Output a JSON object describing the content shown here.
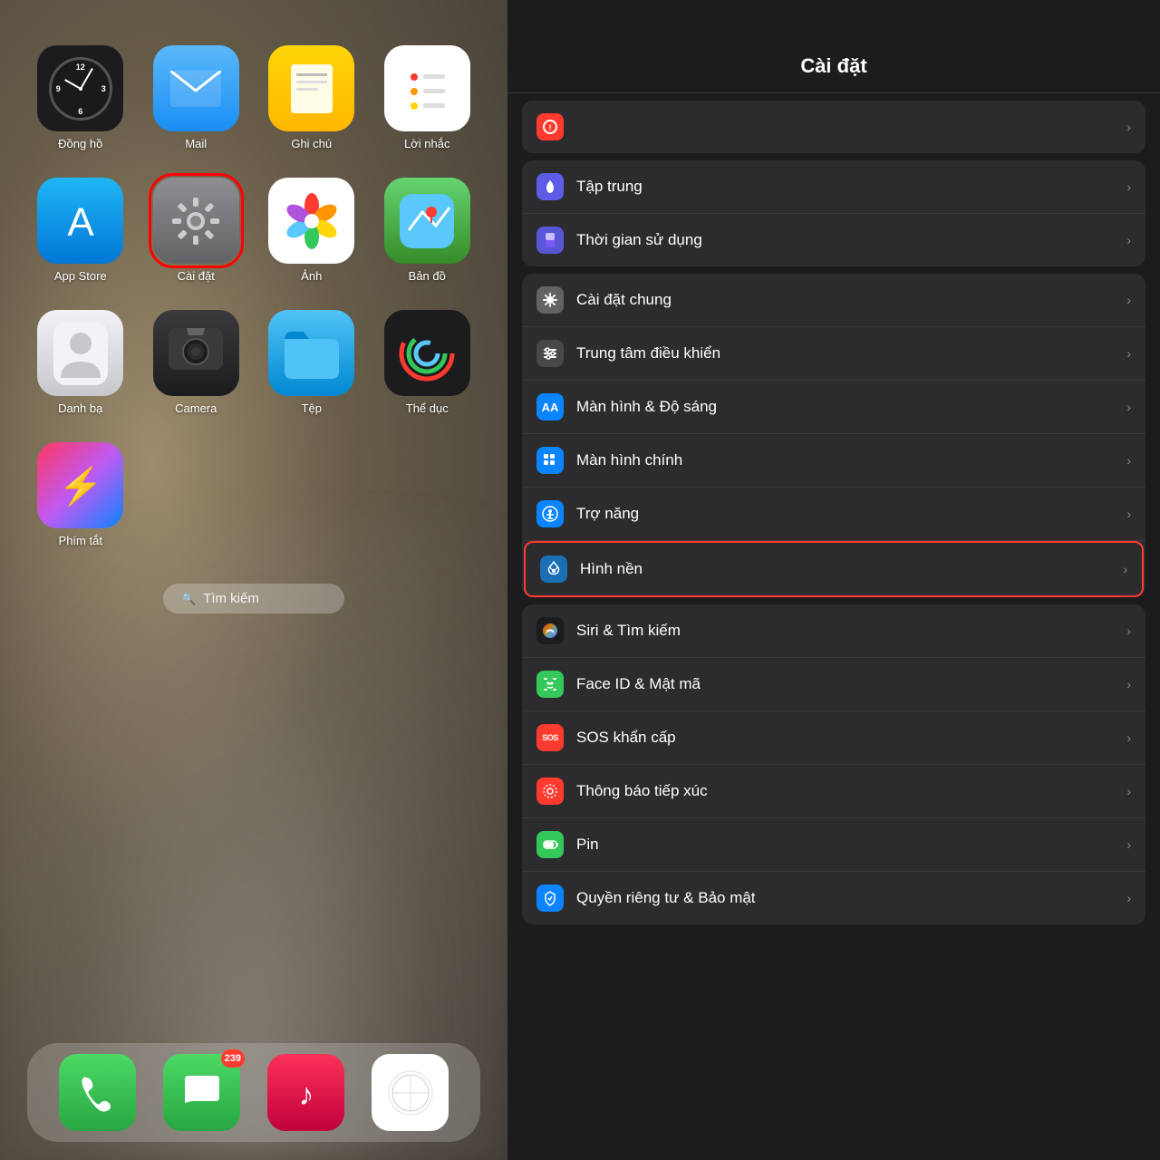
{
  "leftPanel": {
    "apps": [
      {
        "id": "clock",
        "label": "Đồng hồ",
        "icon": "clock"
      },
      {
        "id": "mail",
        "label": "Mail",
        "icon": "mail"
      },
      {
        "id": "notes",
        "label": "Ghi chú",
        "icon": "notes"
      },
      {
        "id": "reminders",
        "label": "Lời nhắc",
        "icon": "reminders"
      },
      {
        "id": "appstore",
        "label": "App Store",
        "icon": "appstore"
      },
      {
        "id": "settings",
        "label": "Cài đặt",
        "icon": "settings",
        "selected": true
      },
      {
        "id": "photos",
        "label": "Ảnh",
        "icon": "photos"
      },
      {
        "id": "maps",
        "label": "Bản đồ",
        "icon": "maps"
      },
      {
        "id": "contacts",
        "label": "Danh bạ",
        "icon": "contacts"
      },
      {
        "id": "camera",
        "label": "Camera",
        "icon": "camera"
      },
      {
        "id": "files",
        "label": "Tệp",
        "icon": "files"
      },
      {
        "id": "fitness",
        "label": "Thể dục",
        "icon": "fitness"
      },
      {
        "id": "shortcuts",
        "label": "Phím tắt",
        "icon": "shortcuts"
      }
    ],
    "searchBar": {
      "icon": "🔍",
      "text": "Tìm kiếm"
    },
    "dock": [
      {
        "id": "phone",
        "label": "Phone",
        "icon": "phone",
        "badge": null
      },
      {
        "id": "messages",
        "label": "Messages",
        "icon": "messages",
        "badge": "239"
      },
      {
        "id": "music",
        "label": "Music",
        "icon": "music",
        "badge": null
      },
      {
        "id": "safari",
        "label": "Safari",
        "icon": "safari",
        "badge": null
      }
    ]
  },
  "rightPanel": {
    "title": "Cài đặt",
    "partialRow": {
      "label": "",
      "iconColor": "ic-red"
    },
    "groups": [
      {
        "rows": [
          {
            "id": "tap-trung",
            "label": "Tập trung",
            "iconColor": "ic-purple",
            "iconSymbol": "moon"
          },
          {
            "id": "thoi-gian",
            "label": "Thời gian sử dụng",
            "iconColor": "ic-indigo",
            "iconSymbol": "hourglass"
          }
        ]
      },
      {
        "rows": [
          {
            "id": "cai-dat-chung",
            "label": "Cài đặt chung",
            "iconColor": "ic-gray",
            "iconSymbol": "gear"
          },
          {
            "id": "trung-tam-dieu-khien",
            "label": "Trung tâm điều khiển",
            "iconColor": "ic-darkgray",
            "iconSymbol": "sliders"
          },
          {
            "id": "man-hinh-do-sang",
            "label": "Màn hình & Độ sáng",
            "iconColor": "ic-blue",
            "iconSymbol": "AA"
          },
          {
            "id": "man-hinh-chinh",
            "label": "Màn hình chính",
            "iconColor": "ic-blue",
            "iconSymbol": "grid"
          },
          {
            "id": "tro-nang",
            "label": "Trợ năng",
            "iconColor": "ic-blue",
            "iconSymbol": "person-circle"
          },
          {
            "id": "hinh-nen",
            "label": "Hình nền",
            "iconColor": "ic-wallpaper",
            "iconSymbol": "flower",
            "highlighted": true
          }
        ]
      },
      {
        "rows": [
          {
            "id": "siri-tim-kiem",
            "label": "Siri & Tìm kiếm",
            "iconColor": "ic-siri",
            "iconSymbol": "siri"
          },
          {
            "id": "face-id",
            "label": "Face ID & Mật mã",
            "iconColor": "ic-green",
            "iconSymbol": "face"
          },
          {
            "id": "sos",
            "label": "SOS khẩn cấp",
            "iconColor": "ic-red",
            "iconSymbol": "SOS"
          },
          {
            "id": "thong-bao-tiep-xuc",
            "label": "Thông báo tiếp xúc",
            "iconColor": "ic-red",
            "iconSymbol": "contact-notify"
          },
          {
            "id": "pin",
            "label": "Pin",
            "iconColor": "ic-green",
            "iconSymbol": "battery"
          },
          {
            "id": "quyen-rieng-tu",
            "label": "Quyền riêng tư & Bảo mật",
            "iconColor": "ic-blue",
            "iconSymbol": "hand"
          }
        ]
      }
    ]
  }
}
